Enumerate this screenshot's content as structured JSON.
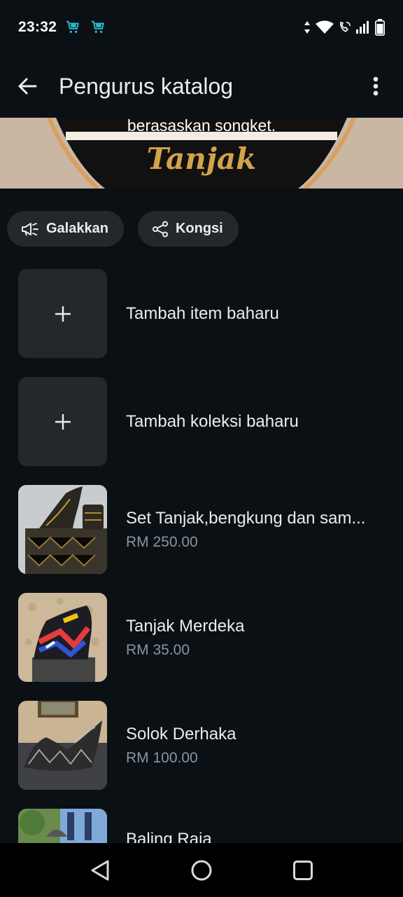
{
  "status_bar": {
    "time": "23:32",
    "notification_icons": [
      "shopping-cart-icon",
      "shopping-cart-icon"
    ],
    "system_icons": [
      "data-arrows-icon",
      "wifi-icon",
      "wifi-calling-icon",
      "signal-icon",
      "battery-icon"
    ]
  },
  "app_bar": {
    "title": "Pengurus katalog",
    "back_icon": "arrow-left-icon",
    "menu_icon": "more-vert-icon"
  },
  "banner": {
    "caption": "berasaskan songket.",
    "logo_text": "Tanjak"
  },
  "actions": [
    {
      "label": "Galakkan",
      "icon": "megaphone-icon"
    },
    {
      "label": "Kongsi",
      "icon": "share-icon"
    }
  ],
  "catalog": {
    "add_item_label": "Tambah item baharu",
    "add_collection_label": "Tambah koleksi baharu",
    "items": [
      {
        "title": "Set Tanjak,bengkung dan sam...",
        "price": "RM 250.00"
      },
      {
        "title": "Tanjak Merdeka",
        "price": "RM 35.00"
      },
      {
        "title": "Solok Derhaka",
        "price": "RM 100.00"
      },
      {
        "title": "Baling Raja",
        "price": ""
      }
    ]
  },
  "colors": {
    "background": "#0b1014",
    "surface": "#22282c",
    "text_primary": "#e9edef",
    "text_secondary": "#8696a0",
    "banner_gold": "#d3a24a"
  }
}
